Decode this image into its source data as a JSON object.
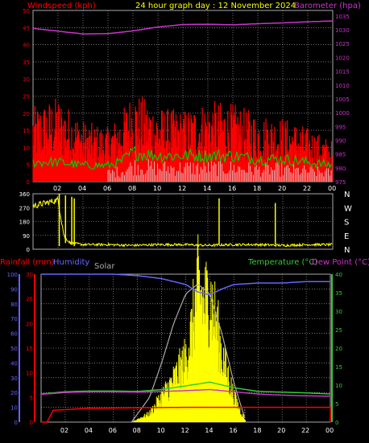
{
  "header": {
    "windspeed_label": "Windspeed (kph)",
    "title": "24 hour graph day : 12 November 2024",
    "barometer_label": "Barometer (hpa)"
  },
  "bottom_header": {
    "rainfall_label": "Rainfall (mm)",
    "humidity_label": "Humidity",
    "solar_label": "Solar",
    "temperature_label": "Temperature (°C)",
    "dewpoint_label": "Dew Point (°C)"
  },
  "colors": {
    "wind": "#ff0000",
    "gust": "#00cc00",
    "avg_wind": "#ffffff",
    "barometer": "#cc33cc",
    "direction": "#ffff00",
    "rain": "#ff0000",
    "humidity": "#6666ff",
    "solar": "#ffff00",
    "solar_max": "#aaaaaa",
    "temperature": "#33cc33",
    "dewpoint": "#cc33cc",
    "title": "#ffff00"
  },
  "chart_data": [
    {
      "type": "line",
      "name": "wind-barometer",
      "x_ticks": [
        "02",
        "04",
        "06",
        "08",
        "10",
        "12",
        "14",
        "16",
        "18",
        "20",
        "22",
        "00"
      ],
      "y_left_ticks": [
        "0",
        "5",
        "10",
        "15",
        "20",
        "25",
        "30",
        "35",
        "40",
        "45",
        "50"
      ],
      "y_left_range": [
        0,
        50
      ],
      "y_right_ticks": [
        "975",
        "980",
        "985",
        "990",
        "995",
        "1000",
        "1005",
        "1010",
        "1015",
        "1020",
        "1025",
        "1030",
        "1035"
      ],
      "y_right_range": [
        975,
        1037
      ],
      "barometer": {
        "x": [
          0,
          2,
          4,
          6,
          8,
          10,
          12,
          14,
          16,
          18,
          20,
          22,
          24
        ],
        "y": [
          1030.5,
          1029.5,
          1028.5,
          1028.6,
          1029.6,
          1031.0,
          1031.9,
          1032.0,
          1031.8,
          1032.2,
          1032.5,
          1032.9,
          1033.2
        ]
      },
      "gust_envelope": {
        "x": [
          0,
          2,
          4,
          6,
          7,
          8,
          10,
          12,
          14,
          16,
          18,
          20,
          22,
          24
        ],
        "y": [
          22,
          25,
          18,
          16,
          20,
          27,
          22,
          21,
          24,
          23,
          20,
          19,
          16,
          12
        ]
      },
      "avg_wind": {
        "x": [
          0,
          2,
          4,
          6,
          7,
          8,
          10,
          12,
          14,
          16,
          18,
          20,
          22,
          24
        ],
        "y": [
          6,
          6,
          5,
          5,
          6,
          9,
          8,
          8,
          8,
          8,
          7,
          7,
          6,
          5
        ]
      },
      "grid": true
    },
    {
      "type": "line",
      "name": "wind-direction",
      "x_ticks": [
        "02",
        "04",
        "06",
        "08",
        "10",
        "12",
        "14",
        "16",
        "18",
        "20",
        "22",
        "00"
      ],
      "y_left_ticks": [
        "0",
        "90",
        "180",
        "270",
        "360"
      ],
      "y_right_ticks": [
        "N",
        "W",
        "S",
        "E",
        "N"
      ],
      "y_range": [
        0,
        360
      ],
      "series": {
        "x": [
          0,
          1,
          2,
          2.5,
          3,
          4,
          6,
          8,
          10,
          12,
          14,
          16,
          17.5,
          18,
          20,
          22,
          24
        ],
        "y": [
          280,
          300,
          320,
          80,
          40,
          30,
          30,
          25,
          30,
          30,
          25,
          30,
          30,
          30,
          25,
          30,
          30
        ]
      },
      "grid": true
    },
    {
      "type": "line",
      "name": "rain-humidity-solar-temperature",
      "x_ticks": [
        "02",
        "04",
        "06",
        "08",
        "10",
        "12",
        "14",
        "16",
        "18",
        "20",
        "22",
        "00"
      ],
      "y_humidity_ticks": [
        "0",
        "10",
        "20",
        "30",
        "40",
        "50",
        "60",
        "70",
        "80",
        "90",
        "100"
      ],
      "y_rain_ticks": [
        "0",
        "5",
        "10",
        "15",
        "20",
        "25",
        "30"
      ],
      "y_temp_ticks": [
        "0",
        "5",
        "10",
        "15",
        "20",
        "25",
        "30",
        "35",
        "40"
      ],
      "humidity": {
        "x": [
          0,
          2,
          4,
          6,
          8,
          10,
          12,
          13,
          14,
          15,
          16,
          18,
          20,
          22,
          24
        ],
        "y": [
          100,
          100,
          100,
          100,
          99,
          97,
          93,
          88,
          86,
          90,
          93,
          94,
          94,
          95,
          95
        ]
      },
      "temperature": {
        "x": [
          0,
          2,
          4,
          6,
          8,
          10,
          12,
          14,
          16,
          18,
          20,
          22,
          24
        ],
        "y": [
          7.6,
          8.2,
          8.4,
          8.4,
          8.3,
          8.8,
          9.8,
          10.8,
          9.3,
          8.3,
          8.1,
          7.9,
          7.6
        ]
      },
      "dewpoint": {
        "x": [
          0,
          2,
          4,
          6,
          8,
          10,
          12,
          14,
          16,
          18,
          20,
          22,
          24
        ],
        "y": [
          7.5,
          8.0,
          8.2,
          8.2,
          8.1,
          8.3,
          8.5,
          8.8,
          8.2,
          7.6,
          7.3,
          7.1,
          7.0
        ]
      },
      "rain": {
        "x": [
          0,
          0.5,
          1,
          4,
          8,
          12,
          16,
          20,
          24
        ],
        "y": [
          0,
          0,
          2.4,
          2.8,
          2.9,
          3.0,
          3.0,
          3.0,
          3.0
        ]
      },
      "solar_max": {
        "x": [
          7.5,
          9,
          10,
          11,
          12,
          13,
          14,
          15,
          16,
          17
        ],
        "y": [
          0,
          5,
          12,
          20,
          26,
          28,
          26,
          18,
          8,
          0
        ]
      },
      "solar": {
        "x": [
          7.5,
          9,
          10,
          11,
          12,
          12.5,
          13,
          13.5,
          14,
          14.5,
          15,
          16,
          17
        ],
        "y": [
          0,
          2,
          6,
          10,
          15,
          22,
          32,
          28,
          30,
          24,
          16,
          6,
          0
        ]
      },
      "grid": true
    }
  ]
}
